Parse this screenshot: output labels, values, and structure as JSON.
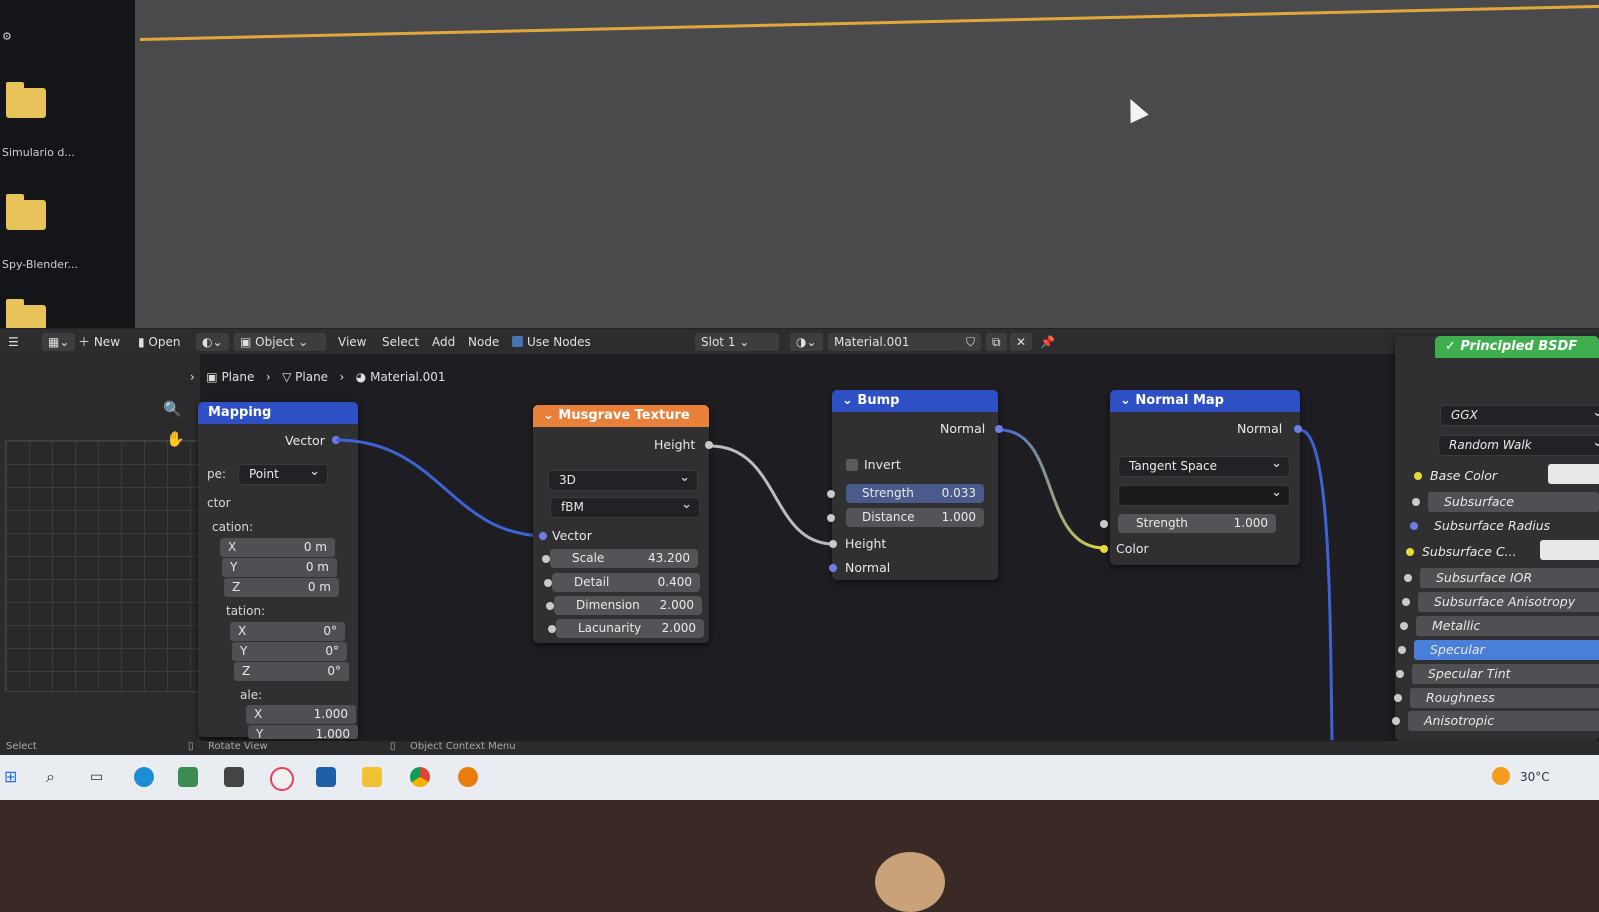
{
  "desktop": {
    "items": [
      {
        "label": "Simulario d..."
      },
      {
        "label": "Spy-Blender..."
      }
    ]
  },
  "header": {
    "new_label": "New",
    "open_label": "Open",
    "mode_label": "Object",
    "menus": [
      "View",
      "Select",
      "Add",
      "Node"
    ],
    "use_nodes_label": "Use Nodes",
    "slot_label": "Slot 1",
    "material_name": "Material.001"
  },
  "breadcrumb": {
    "items": [
      "Plane",
      "Plane",
      "Material.001"
    ]
  },
  "sidebar": {
    "type_label": "pe:",
    "type_value": "Point",
    "vector_label": "ctor",
    "location_label": "cation:",
    "location": [
      {
        "axis": "X",
        "value": "0 m"
      },
      {
        "axis": "Y",
        "value": "0 m"
      },
      {
        "axis": "Z",
        "value": "0 m"
      }
    ],
    "rotation_label": "tation:",
    "rotation": [
      {
        "axis": "X",
        "value": "0°"
      },
      {
        "axis": "Y",
        "value": "0°"
      },
      {
        "axis": "Z",
        "value": "0°"
      }
    ],
    "scale_label": "ale:",
    "scale": [
      {
        "axis": "X",
        "value": "1.000"
      },
      {
        "axis": "Y",
        "value": "1.000"
      }
    ]
  },
  "nodes": {
    "mapping": {
      "title": "Mapping",
      "vector_out": "Vector"
    },
    "musgrave": {
      "title": "Musgrave Texture",
      "height_out": "Height",
      "dimension_mode": "3D",
      "type": "fBM",
      "vector_in": "Vector",
      "fields": [
        {
          "label": "Scale",
          "value": "43.200"
        },
        {
          "label": "Detail",
          "value": "0.400"
        },
        {
          "label": "Dimension",
          "value": "2.000"
        },
        {
          "label": "Lacunarity",
          "value": "2.000"
        }
      ]
    },
    "bump": {
      "title": "Bump",
      "normal_out": "Normal",
      "invert_label": "Invert",
      "fields": [
        {
          "label": "Strength",
          "value": "0.033"
        },
        {
          "label": "Distance",
          "value": "1.000"
        }
      ],
      "height_in": "Height",
      "normal_in": "Normal"
    },
    "normal_map": {
      "title": "Normal Map",
      "normal_out": "Normal",
      "space": "Tangent Space",
      "uv_value": "",
      "strength_label": "Strength",
      "strength_value": "1.000",
      "color_in": "Color"
    },
    "principled": {
      "title": "Principled BSDF",
      "distribution": "GGX",
      "subsurface_method": "Random Walk",
      "inputs": [
        "Base Color",
        "Subsurface",
        "Subsurface Radius",
        "Subsurface C...",
        "Subsurface IOR",
        "Subsurface Anisotropy",
        "Metallic",
        "Specular",
        "Specular Tint",
        "Roughness",
        "Anisotropic"
      ]
    }
  },
  "statusbar": {
    "select": "Select",
    "rotate": "Rotate View",
    "context": "Object Context Menu"
  },
  "taskbar": {
    "temperature": "30°C"
  },
  "colors": {
    "accent_orange": "#e3a63b",
    "node_blue": "#2f4fc4",
    "node_orange": "#e9803a",
    "node_green": "#3fae4f",
    "link_blue": "#3e63d6",
    "link_yellow": "#e6da3a",
    "selected_blue": "#4a7fd9"
  }
}
